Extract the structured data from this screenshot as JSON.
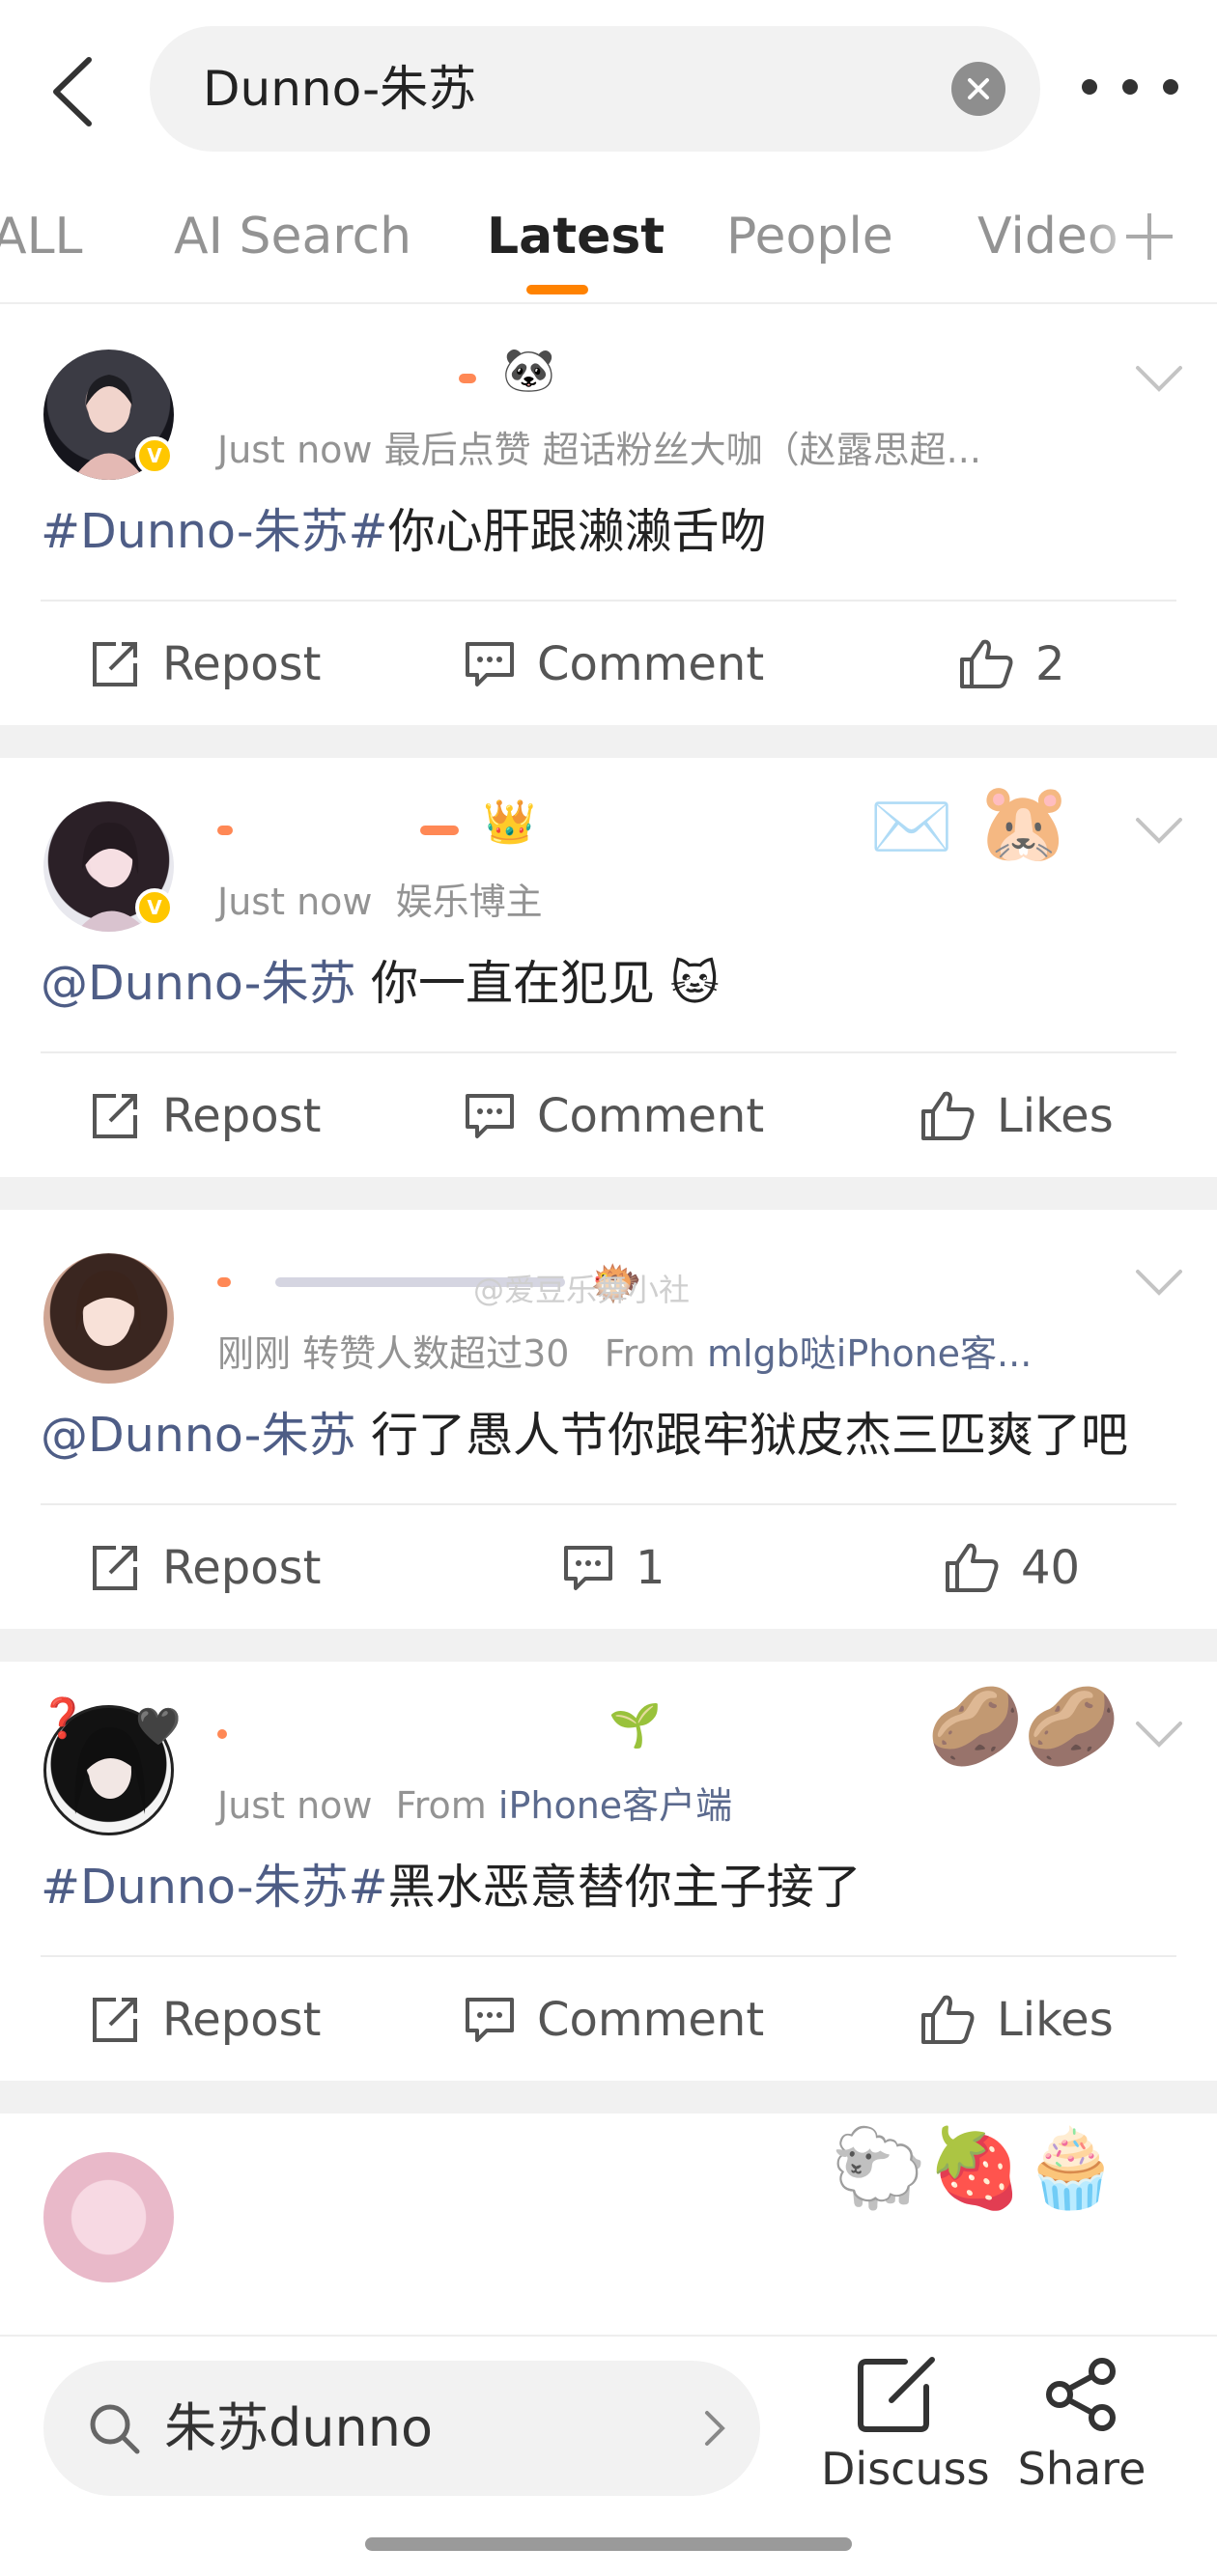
{
  "header": {
    "search_value": "Dunno-朱苏"
  },
  "tabs": [
    {
      "label": "ALL"
    },
    {
      "label": "AI Search"
    },
    {
      "label": "Latest"
    },
    {
      "label": "People"
    },
    {
      "label": "Video"
    }
  ],
  "active_tab": "Latest",
  "accent_color": "#ff8200",
  "posts": [
    {
      "time": "Just now",
      "meta": "最后点赞   超话粉丝大咖（赵露思超...",
      "topic": "#Dunno-朱苏#",
      "text": "你心肝跟濑濑舌吻",
      "repost": "Repost",
      "comment": "Comment",
      "likes": "2"
    },
    {
      "time": "Just now",
      "meta": "娱乐博主",
      "mention": "@Dunno-朱苏",
      "text": " 你一直在犯见 ",
      "repost": "Repost",
      "comment": "Comment",
      "likes": "Likes"
    },
    {
      "time": "刚刚",
      "meta": "转赞人数超过30",
      "source_prefix": "From",
      "source": "mlgb哒iPhone客...",
      "watermark": "@爱豆乐舞小社",
      "mention": "@Dunno-朱苏",
      "text": " 行了愚人节你跟牢狱皮杰三匹爽了吧",
      "repost": "Repost",
      "comment": "1",
      "likes": "40"
    },
    {
      "time": "Just now",
      "source_prefix": "From",
      "source": "iPhone客户端",
      "topic": "#Dunno-朱苏#",
      "text": "黑水恶意替你主子接了",
      "repost": "Repost",
      "comment": "Comment",
      "likes": "Likes"
    }
  ],
  "bottom_bar": {
    "search_text": "朱苏dunno",
    "discuss_label": "Discuss",
    "share_label": "Share"
  }
}
